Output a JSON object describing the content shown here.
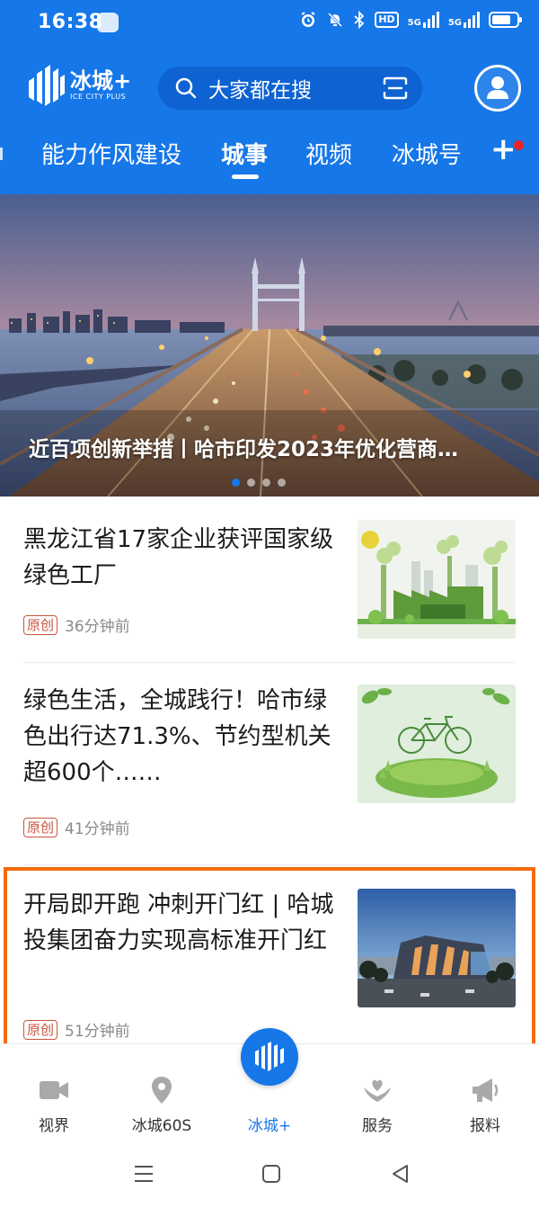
{
  "status": {
    "time": "16:38",
    "network_hd": "HD",
    "signal1": "5G",
    "signal2": "5G"
  },
  "header": {
    "logo_cn": "冰城+",
    "logo_en": "ICE CITY PLUS",
    "search_placeholder": "大家都在搜"
  },
  "tabs": [
    {
      "label": "能力作风建设",
      "active": false
    },
    {
      "label": "城事",
      "active": true
    },
    {
      "label": "视频",
      "active": false
    },
    {
      "label": "冰城号",
      "active": false
    }
  ],
  "banner": {
    "title": "近百项创新举措丨哈市印发2023年优化营商…",
    "slides": 4,
    "current": 1
  },
  "news": [
    {
      "title": "黑龙江省17家企业获评国家级绿色工厂",
      "tag": "原创",
      "time": "36分钟前",
      "image": "green-factory-illustration"
    },
    {
      "title": "绿色生活，全城践行！哈市绿色出行达71.3%、节约型机关超600个……",
      "tag": "原创",
      "time": "41分钟前",
      "image": "bicycle-illustration"
    },
    {
      "title": "开局即开跑 冲刺开门红 | 哈城投集团奋力实现高标准开门红",
      "tag": "原创",
      "time": "51分钟前",
      "image": "building-rendering",
      "highlighted": true
    }
  ],
  "bottom_nav": [
    {
      "label": "视界",
      "icon": "video-camera-icon",
      "active": false
    },
    {
      "label": "冰城60S",
      "icon": "location-pin-icon",
      "active": false
    },
    {
      "label": "冰城+",
      "icon": "ice-city-logo-icon",
      "active": true
    },
    {
      "label": "服务",
      "icon": "heart-hands-icon",
      "active": false
    },
    {
      "label": "报料",
      "icon": "megaphone-icon",
      "active": false
    }
  ],
  "colors": {
    "brand": "#1677e8",
    "highlight_border": "#f26b0f",
    "tag": "#c8553d",
    "notification_dot": "#e52424"
  }
}
